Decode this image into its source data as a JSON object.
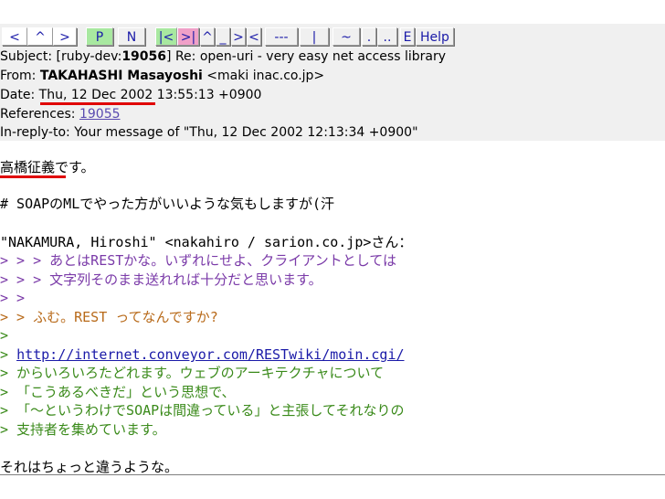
{
  "nav": {
    "buttons": [
      {
        "label": "<",
        "style": "white"
      },
      {
        "label": "^",
        "style": "white"
      },
      {
        "label": ">",
        "style": "white"
      },
      {
        "label": "P",
        "style": "green"
      },
      {
        "label": "N",
        "style": "plain"
      },
      {
        "label": "|<",
        "style": "green"
      },
      {
        "label": ">|",
        "style": "pink"
      },
      {
        "label": "^",
        "style": "plain"
      },
      {
        "label": "_",
        "style": "plain"
      },
      {
        "label": ">",
        "style": "plain"
      },
      {
        "label": "<",
        "style": "plain"
      },
      {
        "label": "---",
        "style": "plain"
      },
      {
        "label": "|",
        "style": "plain"
      },
      {
        "label": "~",
        "style": "plain"
      },
      {
        "label": ".",
        "style": "plain"
      },
      {
        "label": "..",
        "style": "plain"
      },
      {
        "label": "E",
        "style": "plain"
      },
      {
        "label": "Help",
        "style": "plain"
      }
    ]
  },
  "headers": {
    "subject_prefix": "Subject: [ruby-dev:",
    "subject_num": "19056",
    "subject_rest": "] Re: open-uri - very easy net access library",
    "from_label": "From: ",
    "from_name": "TAKAHASHI Masayoshi",
    "from_addr": " <maki inac.co.jp>",
    "date_label": "Date: ",
    "date_value": "Thu, 12 Dec 2002",
    "date_rest": " 13:55:13 +0900",
    "refs_label": "References: ",
    "refs_link": "19055",
    "inreply": "In-reply-to: Your message of \"Thu, 12 Dec 2002 12:13:34 +0900\""
  },
  "body": {
    "l1_name": "高橋征義",
    "l1_rest": "です。",
    "l2": "# SOAPのMLでやった方がいいような気もしますが(汗",
    "l3": "\"NAKAMURA, Hiroshi\" <nakahiro / sarion.co.jp>さん：",
    "l4": "> > > あとはRESTかな。いずれにせよ、クライアントとしては",
    "l5": "> > > 文字列そのまま送れれば十分だと思います。",
    "l6": "> >",
    "l7": "> > ふむ。REST ってなんですか?",
    "l8": ">",
    "l9_prefix": "> ",
    "l9_link": "http://internet.conveyor.com/RESTwiki/moin.cgi/",
    "l10": "> からいろいろたどれます。ウェブのアーキテクチャについて",
    "l11": "> 「こうあるべきだ」という思想で、",
    "l12": "> 「～というわけでSOAPは間違っている」と主張してそれなりの",
    "l13": "> 支持者を集めています。",
    "l14": "それはちょっと違うような。"
  },
  "colors": {
    "underline": "#e00000",
    "quote3": "#7a3aa8",
    "quote2": "#b86a1a",
    "quote1": "#3a8a1a",
    "link": "#1a1aa8"
  }
}
